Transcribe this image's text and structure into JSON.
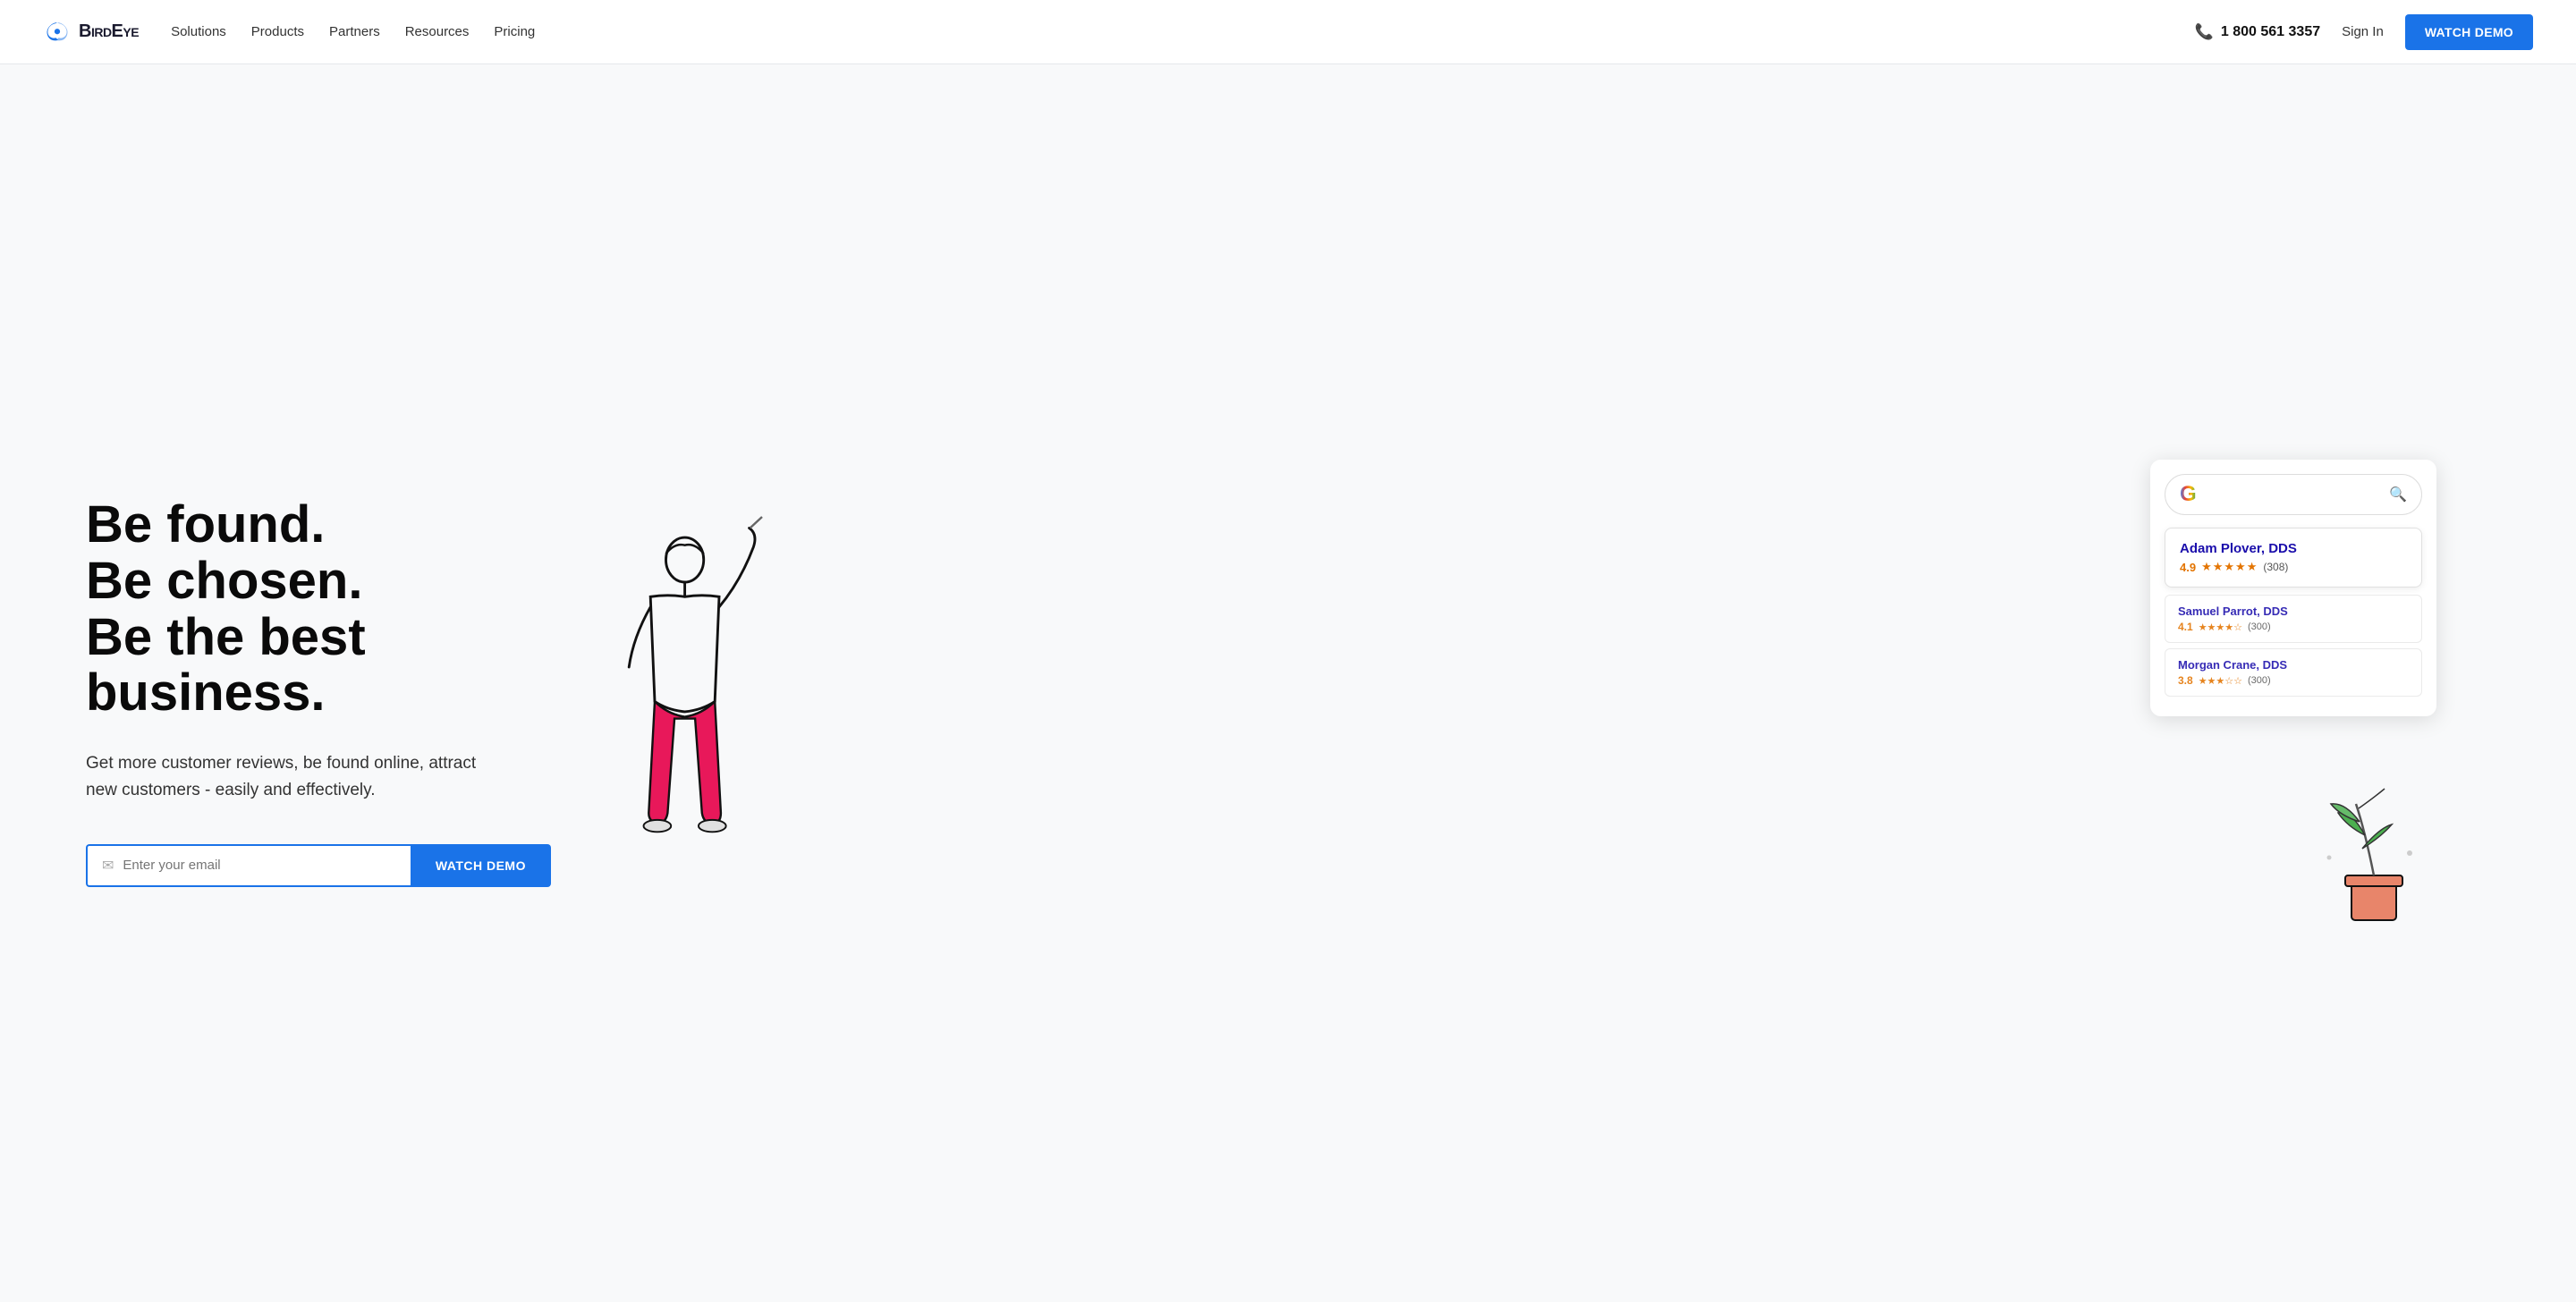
{
  "nav": {
    "logo_text": "BirdEye",
    "links": [
      {
        "label": "Solutions",
        "id": "solutions"
      },
      {
        "label": "Products",
        "id": "products"
      },
      {
        "label": "Partners",
        "id": "partners"
      },
      {
        "label": "Resources",
        "id": "resources"
      },
      {
        "label": "Pricing",
        "id": "pricing"
      }
    ],
    "phone": "1 800 561 3357",
    "sign_in": "Sign In",
    "watch_demo": "WATCH DEMO"
  },
  "hero": {
    "headline_line1": "Be found.",
    "headline_line2": "Be chosen.",
    "headline_line3": "Be the best business.",
    "subtext": "Get more customer reviews, be found online, attract new customers - easily and effectively.",
    "email_placeholder": "Enter your email",
    "watch_demo_btn": "WATCH DEMO"
  },
  "google_widget": {
    "g_letter": "G",
    "results": [
      {
        "name": "Adam Plover, DDS",
        "rating": "4.9",
        "stars": 5,
        "count": "(308)"
      },
      {
        "name": "Samuel Parrot, DDS",
        "rating": "4.1",
        "stars": 4,
        "count": "(300)"
      },
      {
        "name": "Morgan Crane, DDS",
        "rating": "3.8",
        "stars": 3,
        "count": "(300)"
      }
    ]
  },
  "colors": {
    "accent_blue": "#1a73e8",
    "star_orange": "#e37400",
    "link_blue": "#1a0dab"
  }
}
